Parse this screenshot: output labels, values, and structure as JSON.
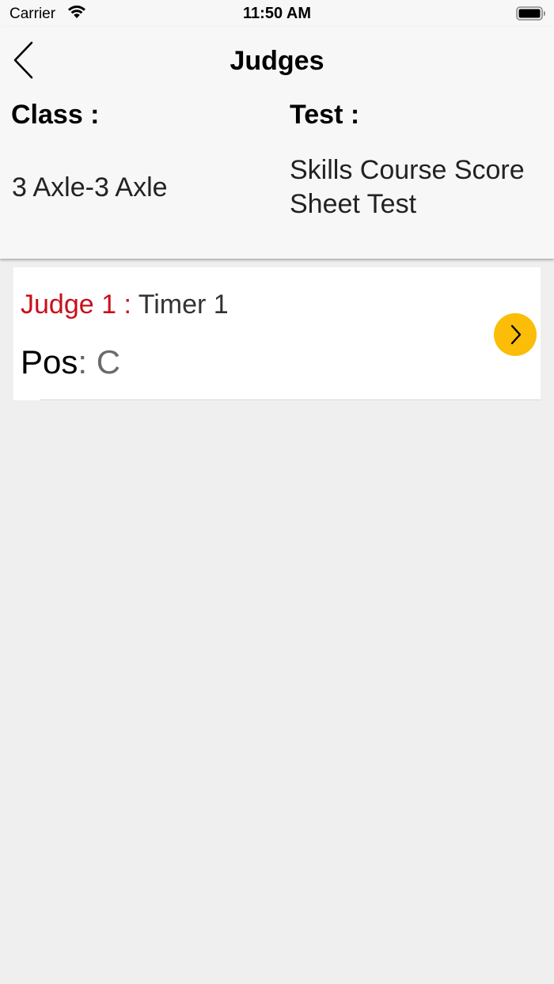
{
  "status_bar": {
    "carrier": "Carrier",
    "time": "11:50 AM"
  },
  "header": {
    "title": "Judges",
    "class_label": "Class :",
    "class_value": "3 Axle-3 Axle",
    "test_label": "Test :",
    "test_value": "Skills Course Score Sheet Test"
  },
  "judges": [
    {
      "label": "Judge 1 : ",
      "name": "Timer 1",
      "pos_label": "Pos",
      "pos_separator": ": ",
      "pos_value": "C"
    }
  ],
  "colors": {
    "judge_label": "#c8101c",
    "chevron_button": "#fbbd07",
    "background": "#efefef",
    "header_background": "#f7f7f7"
  },
  "icons": {
    "back": "chevron-left-icon",
    "row_action": "chevron-right-icon",
    "wifi": "wifi-icon",
    "battery": "battery-icon"
  }
}
